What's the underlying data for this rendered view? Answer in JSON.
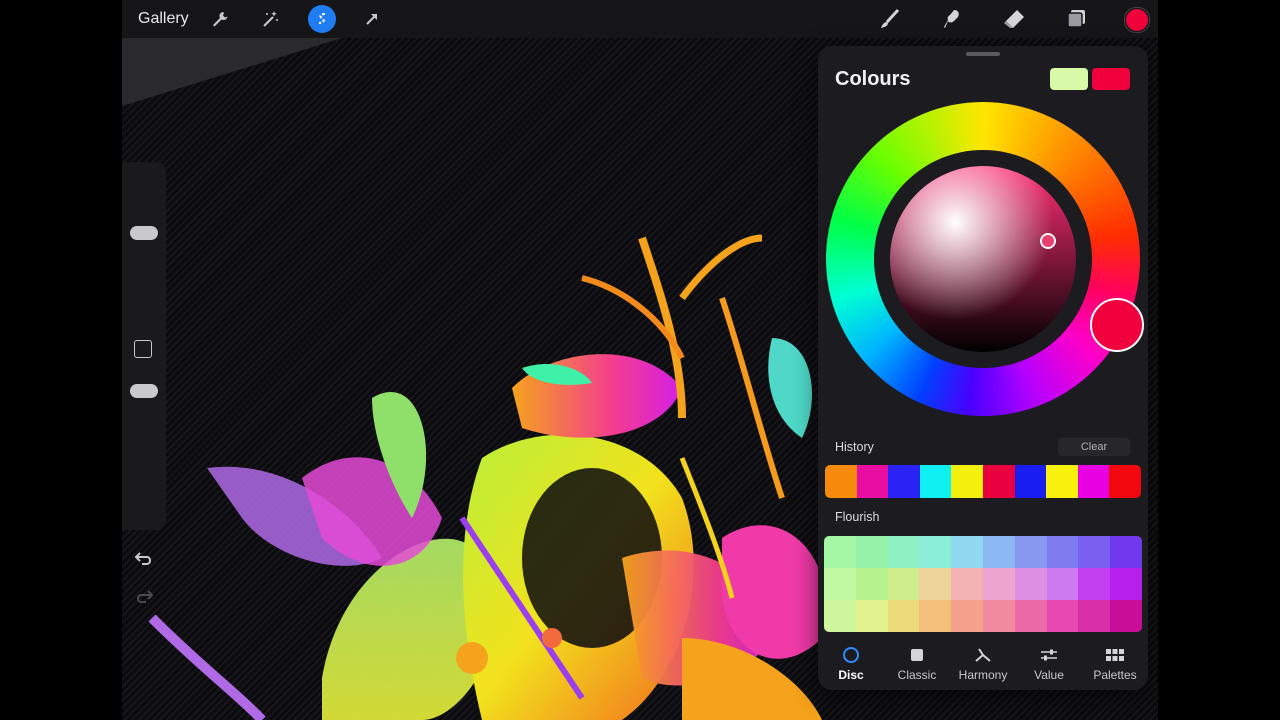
{
  "topbar": {
    "gallery_label": "Gallery",
    "icons": [
      "wrench-icon",
      "magic-wand-icon",
      "selection-icon",
      "transform-arrow-icon",
      "brush-icon",
      "smudge-icon",
      "eraser-icon",
      "layers-icon",
      "colour-dot"
    ],
    "active_colour": "#f0003c"
  },
  "colours_panel": {
    "title": "Colours",
    "current_colour": "#f0003c",
    "previous_colour": "#d8f9a8",
    "history_label": "History",
    "clear_label": "Clear",
    "history": [
      "#f58a0d",
      "#e90da1",
      "#2b22f5",
      "#0ff0f2",
      "#f5ef0d",
      "#e8003f",
      "#1a1df0",
      "#f8f20d",
      "#e600e2",
      "#f1070d"
    ],
    "palette_name": "Flourish",
    "palette_colours": [
      "#a4f7a4",
      "#95f4a9",
      "#8ff0c4",
      "#8beed9",
      "#8fd8ef",
      "#8bb8f2",
      "#8898f0",
      "#7d7bee",
      "#7a5ff0",
      "#6f38ec",
      "#bff8a0",
      "#b6f48e",
      "#cfee8e",
      "#eed49a",
      "#f2b3b4",
      "#eda4cf",
      "#dd8fe4",
      "#cd7af0",
      "#c23ff0",
      "#b520ec",
      "#d1f79e",
      "#e1f28e",
      "#ecdb7a",
      "#f3c07c",
      "#f4a08c",
      "#f08a9e",
      "#ec6aa8",
      "#e64ab0",
      "#d82fa8",
      "#c90f9a"
    ],
    "tabs": [
      {
        "label": "Disc",
        "icon": "disc-icon",
        "active": true
      },
      {
        "label": "Classic",
        "icon": "classic-square-icon",
        "active": false
      },
      {
        "label": "Harmony",
        "icon": "harmony-icon",
        "active": false
      },
      {
        "label": "Value",
        "icon": "value-sliders-icon",
        "active": false
      },
      {
        "label": "Palettes",
        "icon": "palettes-grid-icon",
        "active": false
      }
    ]
  },
  "sidebar": {
    "icons": [
      "brush-size-slider",
      "modify-button",
      "opacity-slider",
      "undo-icon",
      "redo-icon"
    ]
  }
}
